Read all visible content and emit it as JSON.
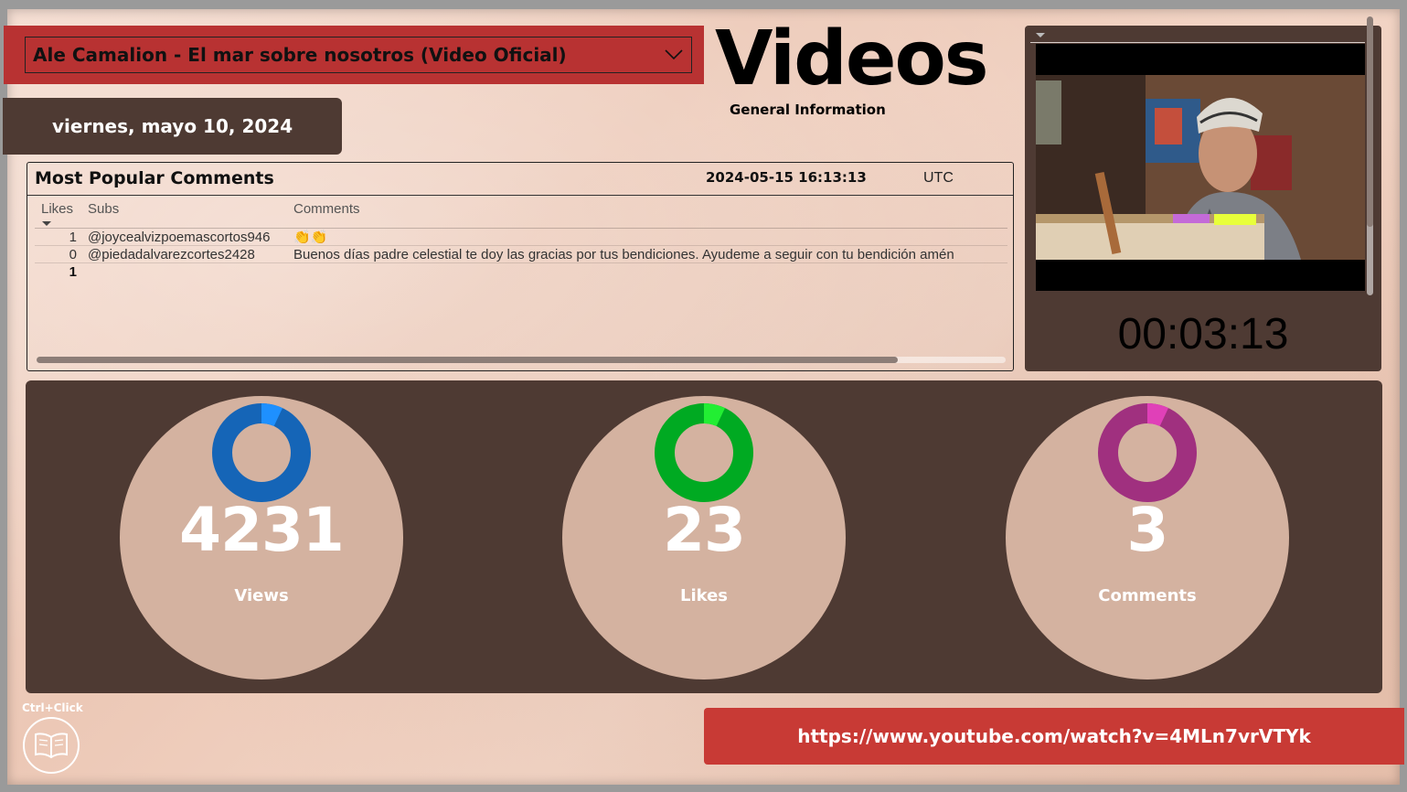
{
  "video_selector": {
    "selected": "Ale Camalion - El mar sobre nosotros (Video Oficial)"
  },
  "date": "viernes, mayo 10, 2024",
  "header": {
    "title": "Videos",
    "subtitle": "General Information"
  },
  "comments": {
    "title": "Most Popular Comments",
    "timestamp": "2024-05-15 16:13:13",
    "timezone": "UTC",
    "columns": [
      "Likes",
      "Subs",
      "Comments"
    ],
    "rows": [
      {
        "likes": "1",
        "sub": "@joycealvizpoemascortos946",
        "comment": "👏👏"
      },
      {
        "likes": "0",
        "sub": "@piedadalvarezcortes2428",
        "comment": "Buenos días padre celestial te doy las gracias por tus bendiciones. Ayudeme a seguir con tu bendición amén"
      }
    ],
    "total_likes": "1"
  },
  "video": {
    "duration": "00:03:13"
  },
  "kpis": [
    {
      "value": "4231",
      "label": "Views",
      "color": "#1565b7",
      "accent": "#1e90ff",
      "fraction": 0.07
    },
    {
      "value": "23",
      "label": "Likes",
      "color": "#00aa22",
      "accent": "#22ee33",
      "fraction": 0.07
    },
    {
      "value": "3",
      "label": "Comments",
      "color": "#a0307f",
      "accent": "#e040b8",
      "fraction": 0.07
    }
  ],
  "footer": {
    "ctrl_click": "Ctrl+Click",
    "url": "https://www.youtube.com/watch?v=4MLn7vrVTYk"
  },
  "icons": {
    "dropdown": "chevron-down-icon",
    "book": "book-icon"
  }
}
